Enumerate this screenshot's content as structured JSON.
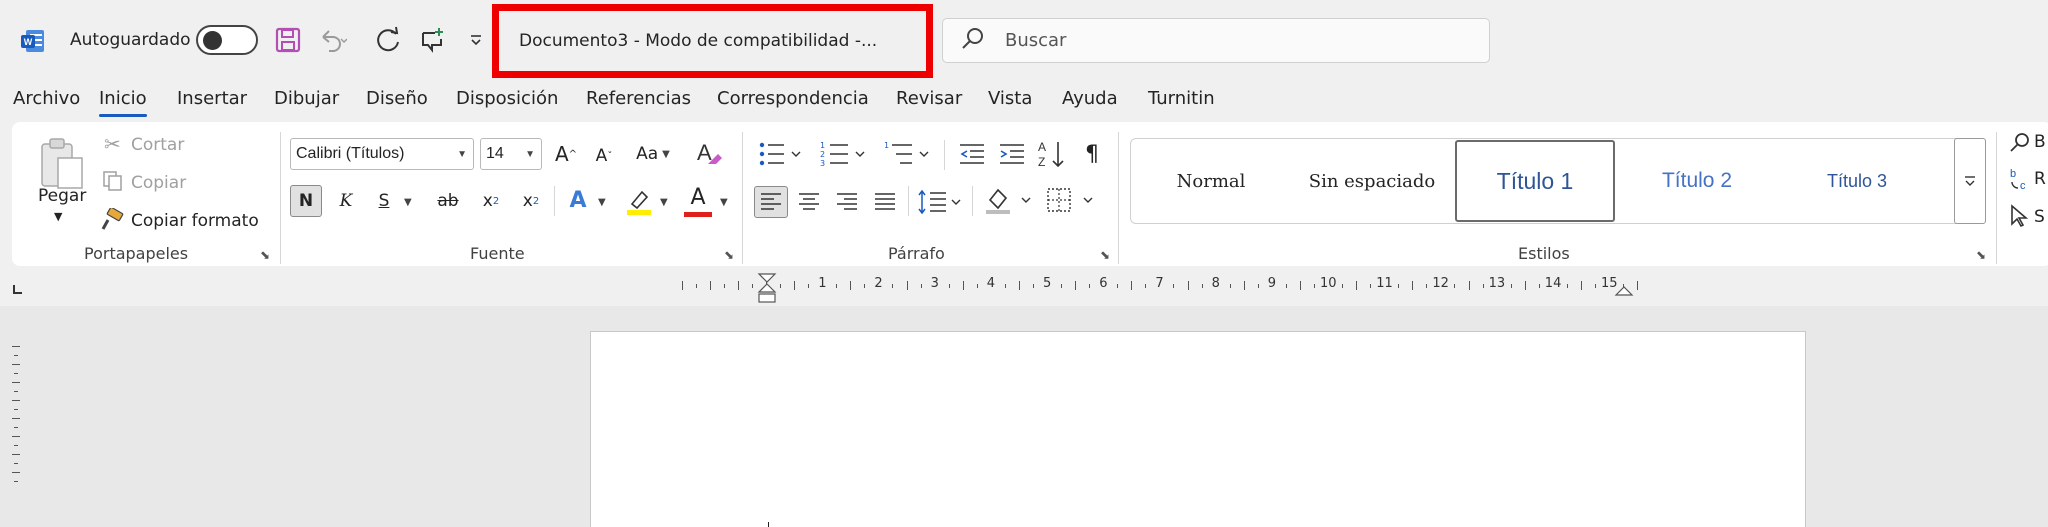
{
  "titlebar": {
    "autosave_label": "Autoguardado",
    "document_title": "Documento3  -  Modo de compatibilidad  -...",
    "search_placeholder": "Buscar"
  },
  "menu": {
    "tabs": [
      "Archivo",
      "Inicio",
      "Insertar",
      "Dibujar",
      "Diseño",
      "Disposición",
      "Referencias",
      "Correspondencia",
      "Revisar",
      "Vista",
      "Ayuda",
      "Turnitin"
    ],
    "active": "Inicio"
  },
  "ribbon": {
    "clipboard": {
      "paste_label": "Pegar",
      "cut_label": "Cortar",
      "copy_label": "Copiar",
      "format_painter_label": "Copiar formato",
      "group_label": "Portapapeles"
    },
    "font": {
      "font_name": "Calibri (Títulos)",
      "font_size": "14",
      "case_label": "Aa",
      "bold_label": "N",
      "italic_label": "K",
      "underline_label": "S",
      "strike_label": "ab",
      "subscript_label": "x",
      "superscript_label": "x",
      "text_effects_label": "A",
      "font_color_label": "A",
      "group_label": "Fuente"
    },
    "paragraph": {
      "group_label": "Párrafo"
    },
    "styles": {
      "items": [
        "Normal",
        "Sin espaciado",
        "Título 1",
        "Título 2",
        "Título 3"
      ],
      "selected": "Título 1",
      "group_label": "Estilos"
    },
    "editing": {
      "items": [
        "B",
        "R",
        "S"
      ]
    }
  },
  "ruler": {
    "numbers": [
      "1",
      "2",
      "3",
      "4",
      "5",
      "6",
      "7",
      "8",
      "9",
      "10",
      "11",
      "12",
      "13",
      "14",
      "15"
    ]
  },
  "colors": {
    "accent": "#185abd",
    "highlight_box": "#ee0000",
    "save_icon": "#b24eb5",
    "highlight_yellow": "#ffee00",
    "font_red": "#e0201a",
    "heading_blue": "#2f5597"
  }
}
